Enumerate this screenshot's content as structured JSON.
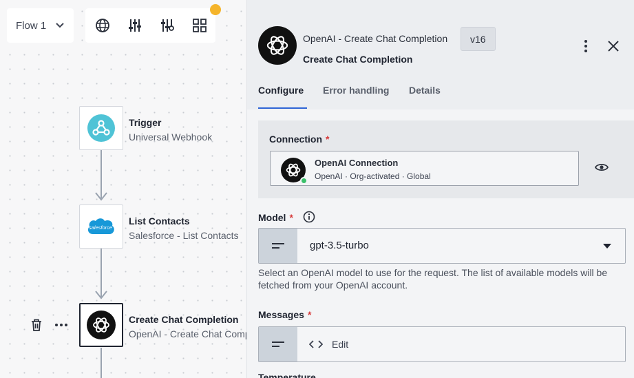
{
  "canvas": {
    "flow_select": {
      "label": "Flow 1"
    },
    "toolbar": {
      "icons": [
        "globe-icon",
        "sliders-icon",
        "adjust-icon",
        "grid-icon"
      ],
      "notification_color": "#f5b42a"
    },
    "steps": [
      {
        "title": "Trigger",
        "subtitle": "Universal Webhook",
        "icon": "webhook-icon"
      },
      {
        "title": "List Contacts",
        "subtitle": "Salesforce - List Contacts",
        "icon": "salesforce-icon",
        "logo_text": "salesforce"
      },
      {
        "title": "Create Chat Completion",
        "subtitle": "OpenAI - Create Chat Completion",
        "icon": "openai-icon"
      }
    ]
  },
  "panel": {
    "app_name": "OpenAI - Create Chat Completion",
    "version": "v16",
    "title": "Create Chat Completion",
    "tabs": [
      {
        "label": "Configure",
        "active": true
      },
      {
        "label": "Error handling",
        "active": false
      },
      {
        "label": "Details",
        "active": false
      }
    ],
    "connection": {
      "label": "Connection",
      "required_mark": "*",
      "name": "OpenAI Connection",
      "meta": "OpenAI · Org-activated · Global",
      "status_color": "#3ac06a"
    },
    "model": {
      "label": "Model",
      "required_mark": "*",
      "value": "gpt-3.5-turbo",
      "help": "Select an OpenAI model to use for the request. The list of available models will be fetched from your OpenAI account."
    },
    "messages": {
      "label": "Messages",
      "required_mark": "*",
      "edit_label": "Edit"
    },
    "next_field_label": "Temperature"
  },
  "colors": {
    "accent": "#2e64d6",
    "required": "#d63a3a",
    "webhook": "#4fc3d6",
    "salesforce": "#1798d8"
  }
}
